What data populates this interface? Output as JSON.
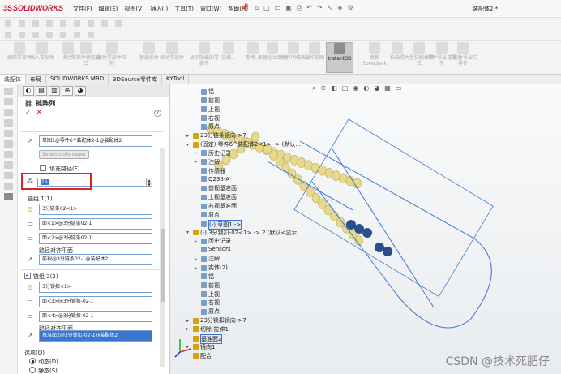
{
  "app": {
    "brand": "SOLIDWORKS",
    "doc_title": "装配体2 *"
  },
  "menu": [
    "文件(F)",
    "编辑(E)",
    "视图(V)",
    "插入(I)",
    "工具(T)",
    "窗口(W)",
    "帮助(H)"
  ],
  "quick_access": [
    "home-icon",
    "new-icon",
    "open-icon",
    "save-icon",
    "print-icon",
    "undo-icon",
    "redo-icon",
    "select-icon",
    "rebuild-icon",
    "options-icon"
  ],
  "ribbon": [
    {
      "label": "编辑零部件",
      "enabled": false
    },
    {
      "label": "插入零部件",
      "enabled": false
    },
    {
      "label": "配合",
      "enabled": false
    },
    {
      "label": "零部件预览窗口",
      "enabled": false
    },
    {
      "label": "线性零部件阵列",
      "enabled": false
    },
    {
      "label": "智能扣件",
      "enabled": false
    },
    {
      "label": "移动零部件",
      "enabled": false
    },
    {
      "label": "显示隐藏的零部件",
      "enabled": false
    },
    {
      "label": "装配...",
      "enabled": false
    },
    {
      "label": "参考...",
      "enabled": false
    },
    {
      "label": "新建运动算例",
      "enabled": false
    },
    {
      "label": "材料明细表",
      "enabled": false
    },
    {
      "label": "爆炸视图",
      "enabled": false
    },
    {
      "label": "Instant3D",
      "enabled": true
    },
    {
      "label": "更新Speedpak",
      "enabled": false
    },
    {
      "label": "拍快照",
      "enabled": false
    },
    {
      "label": "大型装配体模式",
      "enabled": false
    },
    {
      "label": "零件导出与零件",
      "enabled": false
    },
    {
      "label": "装配体导出与零件",
      "enabled": false
    }
  ],
  "tabs": [
    "装配体",
    "布局",
    "SOLIDWORKS MBD",
    "3DSource零件库",
    "KYTool"
  ],
  "pm": {
    "title": "链阵列",
    "path_value": "草图1@零件6^装配体2-1@装配体2",
    "selection_manager": "SelectionManager",
    "fill_path_label": "填充路径(F)",
    "instances": "15",
    "group1": {
      "title": "链组 1(1)",
      "component": "3分链条02<1>",
      "face1": "面<1>@3分链条02-1",
      "face2": "面<2>@3分链条02-1",
      "align_label": "路径对齐平面",
      "align_value": "前视@3分链条02-1@装配体2"
    },
    "group2": {
      "title": "链组 2(2)",
      "component": "3分锁扣<1>",
      "face1": "面<3>@3分锁扣-02-1",
      "face2": "面<4>@3分锁扣-02-1",
      "align_label": "路径对齐平面",
      "align_value": "基准面2@3分锁扣-02-1@装配体2"
    },
    "options": {
      "title": "选项(O)",
      "dynamic": "动态(D)",
      "static": "静态(S)"
    }
  },
  "tree": [
    {
      "text": "铝",
      "indent": 1,
      "expand": ""
    },
    {
      "text": "前视",
      "indent": 1,
      "expand": ""
    },
    {
      "text": "上视",
      "indent": 1,
      "expand": ""
    },
    {
      "text": "右视",
      "indent": 1,
      "expand": ""
    },
    {
      "text": "原点",
      "indent": 1,
      "expand": ""
    },
    {
      "text": "23分链条镜向->7",
      "indent": 0,
      "expand": "▸"
    },
    {
      "text": "(固定) 零件6^装配体2<1> -> (默认...",
      "indent": 0,
      "expand": "▾"
    },
    {
      "text": "历史记录",
      "indent": 1,
      "expand": "▸"
    },
    {
      "text": "注解",
      "indent": 1,
      "expand": "▸"
    },
    {
      "text": "传感器",
      "indent": 1,
      "expand": ""
    },
    {
      "text": "Q235-A",
      "indent": 1,
      "expand": ""
    },
    {
      "text": "前视基准面",
      "indent": 1,
      "expand": ""
    },
    {
      "text": "上视基准面",
      "indent": 1,
      "expand": ""
    },
    {
      "text": "右视基准面",
      "indent": 1,
      "expand": ""
    },
    {
      "text": "原点",
      "indent": 1,
      "expand": ""
    },
    {
      "text": "(-) 草图1 ->",
      "indent": 1,
      "expand": ""
    },
    {
      "text": "(-) 3分锁扣-02<1> -> 2 (默认<显示...",
      "indent": 0,
      "expand": "▾"
    },
    {
      "text": "历史记录",
      "indent": 1,
      "expand": "▸"
    },
    {
      "text": "Sensors",
      "indent": 1,
      "expand": ""
    },
    {
      "text": "注解",
      "indent": 1,
      "expand": "▸"
    },
    {
      "text": "实体(2)",
      "indent": 1,
      "expand": "▸"
    },
    {
      "text": "铝",
      "indent": 1,
      "expand": ""
    },
    {
      "text": "前视",
      "indent": 1,
      "expand": ""
    },
    {
      "text": "上视",
      "indent": 1,
      "expand": ""
    },
    {
      "text": "右视",
      "indent": 1,
      "expand": ""
    },
    {
      "text": "原点",
      "indent": 1,
      "expand": ""
    },
    {
      "text": "23分锁扣镜向->7",
      "indent": 0,
      "expand": "▸"
    },
    {
      "text": "切除-拉伸1",
      "indent": 0,
      "expand": "▸"
    },
    {
      "text": "基准面2",
      "indent": 0,
      "expand": ""
    },
    {
      "text": "镜向1",
      "indent": 0,
      "expand": "▸"
    },
    {
      "text": "配合",
      "indent": 0,
      "expand": ""
    }
  ],
  "watermark": "CSDN @技术死肥仔",
  "colors": {
    "accent_blue": "#3b76d0",
    "highlight_red": "#e1221f",
    "brand_red": "#c8102e",
    "chain_yellow": "#e7d98c"
  }
}
